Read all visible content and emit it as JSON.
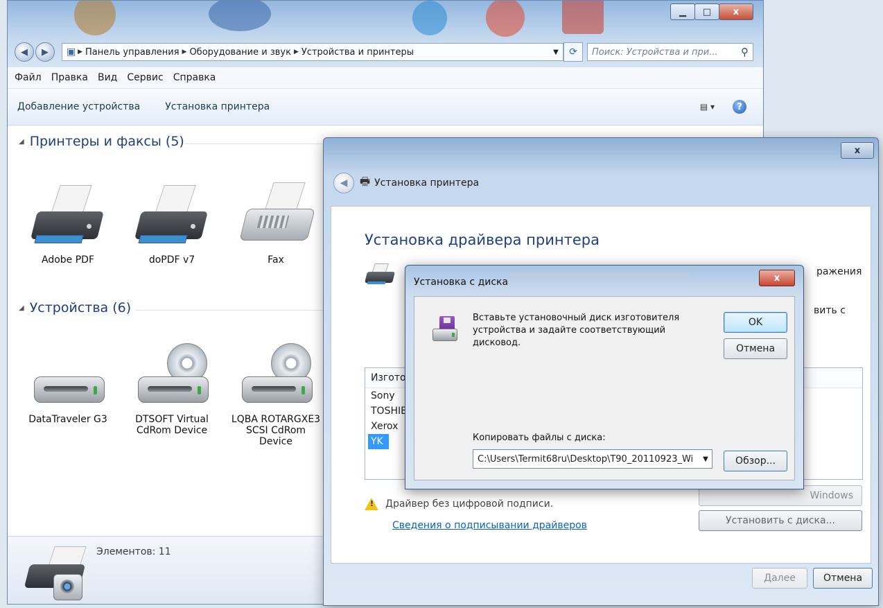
{
  "explorer": {
    "address": [
      "Панель управления",
      "Оборудование и звук",
      "Устройства и принтеры"
    ],
    "search_placeholder": "Поиск: Устройства и при...",
    "menu": [
      "Файл",
      "Правка",
      "Вид",
      "Сервис",
      "Справка"
    ],
    "commands": [
      "Добавление устройства",
      "Установка принтера"
    ],
    "groups": {
      "printers_title": "Принтеры и факсы (5)",
      "devices_title": "Устройства (6)"
    },
    "printers": [
      {
        "label": "Adobe PDF",
        "icon": "printer-icon"
      },
      {
        "label": "doPDF v7",
        "icon": "printer-icon"
      },
      {
        "label": "Fax",
        "icon": "fax-icon"
      }
    ],
    "devices": [
      {
        "label": "DataTraveler G3",
        "icon": "drive-icon"
      },
      {
        "label": "DTSOFT Virtual CdRom Device",
        "icon": "cdrom-icon"
      },
      {
        "label": "LQBA ROTARGXE3 SCSI CdRom Device",
        "icon": "cdrom-icon"
      }
    ],
    "status": "Элементов: 11"
  },
  "wizard": {
    "title": "Установка принтера",
    "heading": "Установка драйвера принтера",
    "right_text_1": "ражения",
    "right_text_2": "вить с",
    "list_header": "Изготов",
    "manufacturers": [
      "Sony",
      "TOSHIB",
      "Xerox",
      "YK"
    ],
    "selected_manufacturer": "YK",
    "warning": "Драйвер без цифровой подписи.",
    "link": "Сведения о подписывании драйверов",
    "windows_update_button": "Windows",
    "have_disk_button": "Установить с диска...",
    "next_button": "Далее",
    "cancel_button": "Отмена",
    "close_glyph": "x"
  },
  "disk_dialog": {
    "title": "Установка с диска",
    "message": "Вставьте установочный диск изготовителя устройства и задайте соответствующий дисковод.",
    "ok_button": "OK",
    "cancel_button": "Отмена",
    "copy_label": "Копировать файлы с диска:",
    "path_value": "C:\\Users\\Termit68ru\\Desktop\\T90_20110923_Wi",
    "browse_button": "Обзор...",
    "close_glyph": "x"
  },
  "colors": {
    "accent": "#1d3f86",
    "selection": "#3399ff",
    "link": "#0a62c8"
  }
}
